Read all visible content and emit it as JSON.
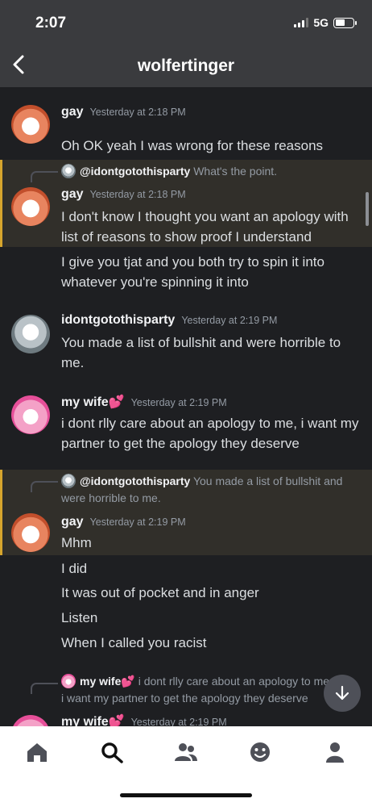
{
  "status": {
    "time": "2:07",
    "network": "5G"
  },
  "header": {
    "title": "wolfertinger"
  },
  "messages": [
    {
      "author": "gay",
      "timestamp": "Yesterday at 2:18 PM",
      "lines": [
        "Oh OK yeah I was wrong for these reasons"
      ]
    },
    {
      "reply_to": {
        "author": "@idontgotothisparty",
        "text": "What's the point."
      },
      "author": "gay",
      "timestamp": "Yesterday at 2:18 PM",
      "lines": [
        "I don't know I thought you want an apology with list of reasons to show proof I understand"
      ],
      "followups": [
        "I give you tjat and you both try to spin it into whatever you're spinning it into"
      ]
    },
    {
      "author": "idontgotothisparty",
      "timestamp": "Yesterday at 2:19 PM",
      "lines": [
        "You made a list of bullshit and were horrible to me."
      ]
    },
    {
      "author": "my wife",
      "author_emoji": "💕",
      "timestamp": "Yesterday at 2:19 PM",
      "lines": [
        "i dont rlly care about an apology to me, i want my partner to get the apology they deserve"
      ]
    },
    {
      "reply_to": {
        "author": "@idontgotothisparty",
        "text": "You made a list of bullshit and were horrible to me."
      },
      "author": "gay",
      "timestamp": "Yesterday at 2:19 PM",
      "lines": [
        "Mhm"
      ],
      "followups": [
        "I did",
        "It was out of pocket and in anger",
        "Listen",
        "When I called you racist"
      ]
    },
    {
      "reply_to": {
        "author": "my wife",
        "author_emoji": "💕",
        "text": "i dont rlly care about an apology to me, i want my partner to get the apology they deserve"
      },
      "author": "my wife",
      "author_emoji": "💕",
      "timestamp": "Yesterday at 2:19 PM"
    }
  ],
  "colors": {
    "background": "#1e1f22",
    "header": "#3a3b3e",
    "highlight": "#312f2a",
    "highlight_border": "#d6a52d",
    "nav": "#ffffff"
  },
  "nav": {
    "icons": [
      "home-icon",
      "search-icon",
      "friends-icon",
      "emoji-icon",
      "profile-icon"
    ]
  }
}
